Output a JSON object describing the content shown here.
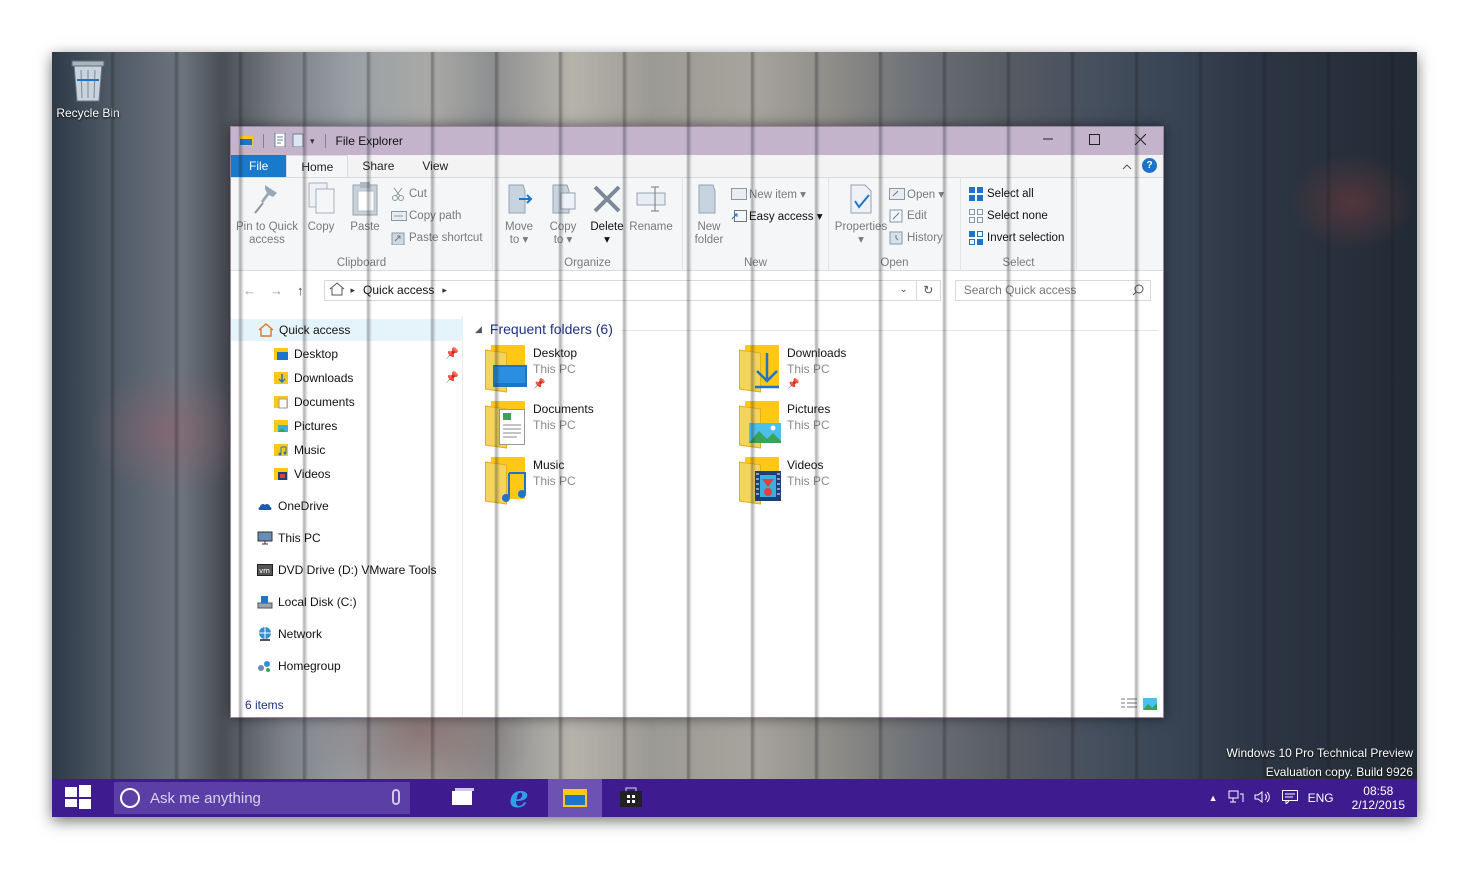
{
  "desktop": {
    "recycle_bin_label": "Recycle Bin",
    "watermark_line1": "Windows 10 Pro Technical Preview",
    "watermark_line2": "Evaluation copy. Build 9926"
  },
  "window": {
    "title": "File Explorer",
    "accent": "#1979ca",
    "titlebar_color": "#c3b4cc",
    "tabs": {
      "file": "File",
      "home": "Home",
      "share": "Share",
      "view": "View"
    }
  },
  "ribbon": {
    "clipboard": {
      "pin_line1": "Pin to Quick",
      "pin_line2": "access",
      "copy": "Copy",
      "paste": "Paste",
      "cut": "Cut",
      "copy_path": "Copy path",
      "paste_shortcut": "Paste shortcut",
      "label": "Clipboard"
    },
    "organize": {
      "move_line1": "Move",
      "move_line2": "to ▾",
      "copy_line1": "Copy",
      "copy_line2": "to ▾",
      "delete": "Delete",
      "delete_arrow": "▾",
      "rename": "Rename",
      "label": "Organize"
    },
    "new": {
      "folder_line1": "New",
      "folder_line2": "folder",
      "new_item": "New item ▾",
      "easy_access": "Easy access ▾",
      "label": "New"
    },
    "open": {
      "properties": "Properties",
      "properties_arrow": "▾",
      "open": "Open ▾",
      "edit": "Edit",
      "history": "History",
      "label": "Open"
    },
    "select": {
      "select_all": "Select all",
      "select_none": "Select none",
      "invert": "Invert selection",
      "label": "Select"
    }
  },
  "address": {
    "crumb": "Quick access",
    "search_placeholder": "Search Quick access"
  },
  "nav": {
    "quick_access": "Quick access",
    "items": [
      {
        "label": "Desktop"
      },
      {
        "label": "Downloads"
      },
      {
        "label": "Documents"
      },
      {
        "label": "Pictures"
      },
      {
        "label": "Music"
      },
      {
        "label": "Videos"
      }
    ],
    "onedrive": "OneDrive",
    "this_pc": "This PC",
    "dvd": "DVD Drive (D:) VMware Tools",
    "local_disk": "Local Disk (C:)",
    "network": "Network",
    "homegroup": "Homegroup"
  },
  "main": {
    "group_header": "Frequent folders (6)",
    "folders": [
      {
        "name": "Desktop",
        "location": "This PC"
      },
      {
        "name": "Downloads",
        "location": "This PC"
      },
      {
        "name": "Documents",
        "location": "This PC"
      },
      {
        "name": "Pictures",
        "location": "This PC"
      },
      {
        "name": "Music",
        "location": "This PC"
      },
      {
        "name": "Videos",
        "location": "This PC"
      }
    ]
  },
  "status": {
    "items": "6 items"
  },
  "taskbar": {
    "search_placeholder": "Ask me anything",
    "lang": "ENG",
    "time": "08:58",
    "date": "2/12/2015",
    "color": "#3e1b8e"
  }
}
